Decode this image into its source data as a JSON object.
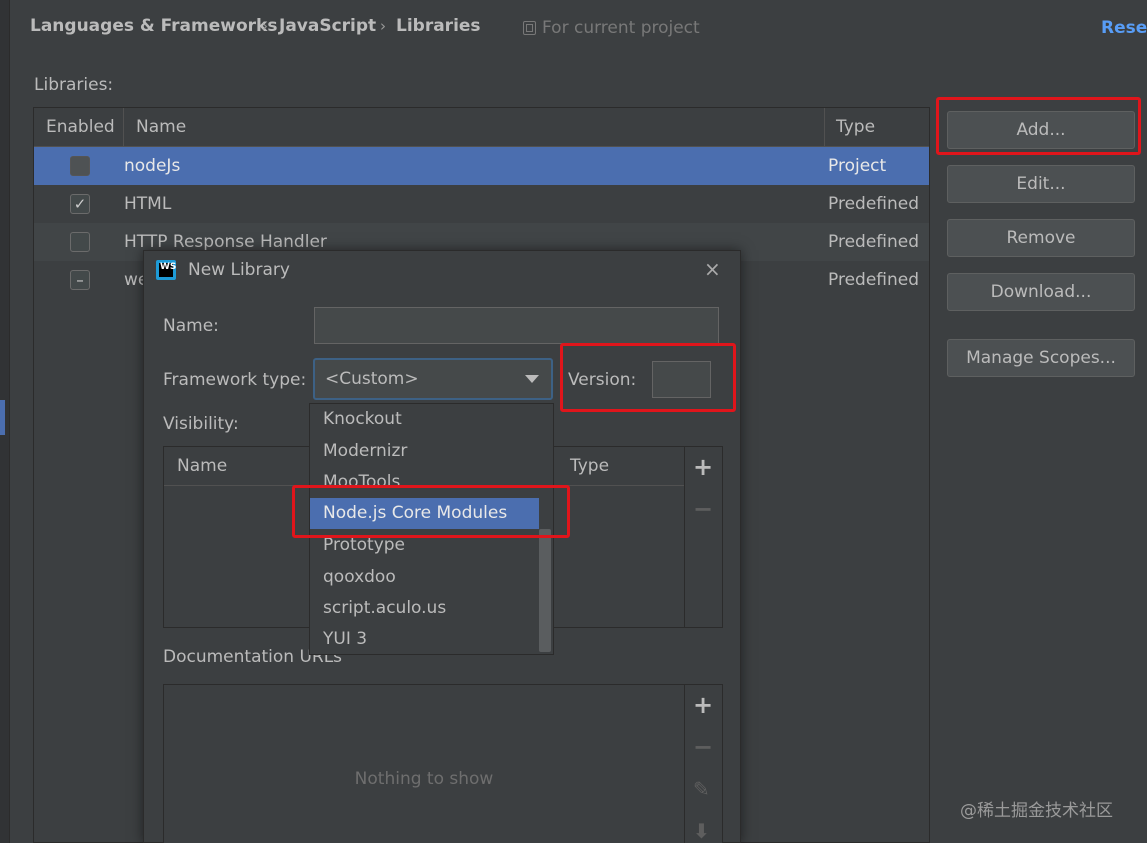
{
  "breadcrumb": {
    "items": [
      "Languages & Frameworks",
      "JavaScript",
      "Libraries"
    ],
    "separator": "›",
    "scope_note": "For current project",
    "reset_label": "Reset"
  },
  "libraries": {
    "label": "Libraries:",
    "columns": [
      "Enabled",
      "Name",
      "Type"
    ],
    "rows": [
      {
        "enabled": "",
        "name": "nodeJs",
        "type": "Project"
      },
      {
        "enabled": "✓",
        "name": "HTML",
        "type": "Predefined"
      },
      {
        "enabled": "",
        "name": "HTTP Response Handler",
        "type": "Predefined"
      },
      {
        "enabled": "–",
        "name": "we",
        "type": "Predefined"
      }
    ]
  },
  "buttons": {
    "add": "Add...",
    "edit": "Edit...",
    "remove": "Remove",
    "download": "Download...",
    "manage_scopes": "Manage Scopes..."
  },
  "dialog": {
    "title": "New Library",
    "icon_text": "WS",
    "close": "×",
    "name_label": "Name:",
    "name_value": "",
    "framework_label": "Framework type:",
    "framework_value": "<Custom>",
    "version_label": "Version:",
    "version_value": "",
    "visibility_label": "Visibility:",
    "visibility_columns": [
      "Name",
      "Type"
    ],
    "doc_urls_label": "Documentation URLs",
    "empty_text": "Nothing to show",
    "add_symbol": "+",
    "remove_symbol": "−",
    "edit_symbol": "✎",
    "download_symbol": "⬇"
  },
  "framework_options": {
    "items": [
      "Knockout",
      "Modernizr",
      "MooTools",
      "Node.js Core Modules",
      "Prototype",
      "qooxdoo",
      "script.aculo.us",
      "YUI 3"
    ],
    "selected": "Node.js Core Modules"
  },
  "watermark": "@稀土掘金技术社区",
  "colors": {
    "background": "#3c3f41",
    "selection": "#4b6eaf",
    "link": "#589df6",
    "highlight_box": "#e0151b"
  }
}
